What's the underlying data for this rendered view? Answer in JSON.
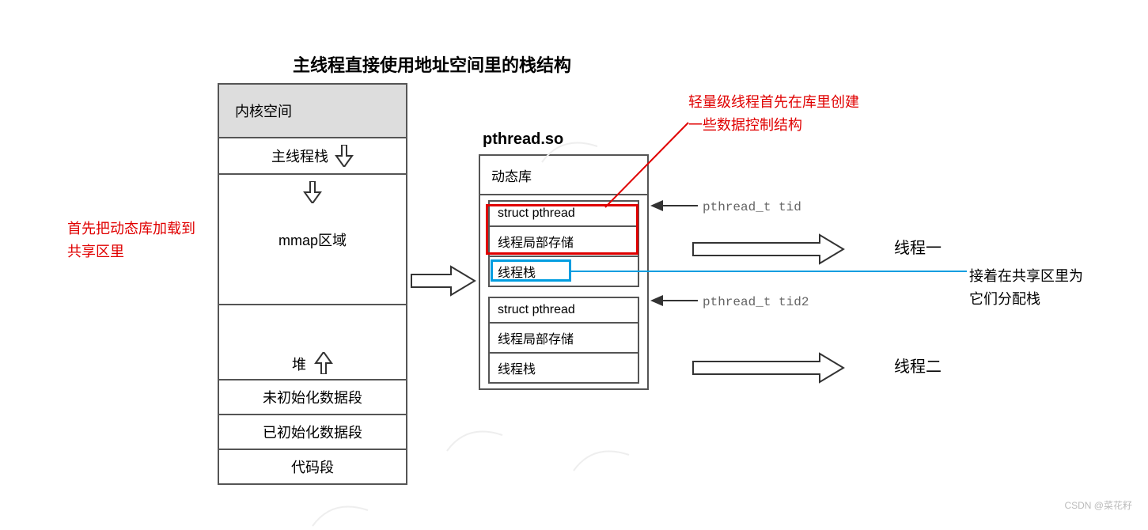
{
  "title": "主线程直接使用地址空间里的栈结构",
  "left_note_1": "首先把动态库加载到",
  "left_note_2": "共享区里",
  "addr": {
    "kernel": "内核空间",
    "mainstack": "主线程栈",
    "mmap": "mmap区域",
    "heap": "堆",
    "bss": "未初始化数据段",
    "data": "已初始化数据段",
    "text": "代码段"
  },
  "lib_title": "pthread.so",
  "lib_header": "动态库",
  "struct1": "struct pthread",
  "tls1": "线程局部存储",
  "stack1": "线程栈",
  "struct2": "struct pthread",
  "tls2": "线程局部存储",
  "stack2": "线程栈",
  "tid1": "pthread_t tid",
  "tid2": "pthread_t tid2",
  "note_top_1": "轻量级线程首先在库里创建",
  "note_top_2": "一些数据控制结构",
  "note_right_1": "接着在共享区里为",
  "note_right_2": "它们分配栈",
  "thread1": "线程一",
  "thread2": "线程二",
  "watermark": "CSDN @菜花籽"
}
